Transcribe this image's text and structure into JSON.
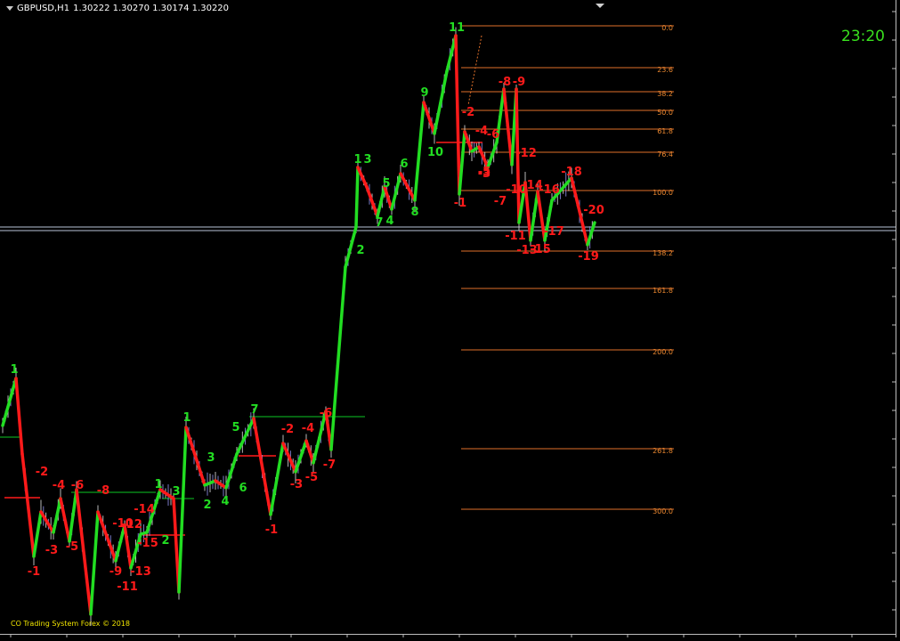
{
  "header": {
    "symbol": "GBPUSD,H1",
    "ohlc": "1.30222 1.30270 1.30174 1.30220"
  },
  "clock": "23:20",
  "credit": "CO Trading System Forex © 2018",
  "colors": {
    "background": "#000000",
    "up_wave": "#22dd22",
    "down_wave": "#ff1a1a",
    "fib_line": "#e0702a",
    "fib_label": "#e8862f",
    "level_line": "#0aa01e",
    "price_line": "#b8c4d8"
  },
  "fibonacci_levels": [
    {
      "label": "0.0"
    },
    {
      "label": "23.6"
    },
    {
      "label": "38.2"
    },
    {
      "label": "50.0"
    },
    {
      "label": "61.8"
    },
    {
      "label": "76.4"
    },
    {
      "label": "100.0"
    },
    {
      "label": "138.2"
    },
    {
      "label": "161.8"
    },
    {
      "label": "200.0"
    },
    {
      "label": "261.8"
    },
    {
      "label": "300.0"
    }
  ],
  "wave_labels_green": [
    "1",
    "1",
    "3",
    "2",
    "1",
    "3",
    "2",
    "4",
    "5",
    "6",
    "7",
    "11",
    "9",
    "10",
    "1",
    "3",
    "5",
    "7",
    "4",
    "6",
    "8",
    "2"
  ],
  "wave_labels_red": [
    "-1",
    "-2",
    "-3",
    "-4",
    "-5",
    "-6",
    "-8",
    "-9",
    "-10",
    "-11",
    "-12",
    "-13",
    "-14",
    "-15",
    "-1",
    "-2",
    "-3",
    "-4",
    "-5",
    "-6",
    "-7",
    "-1",
    "-2",
    "-3",
    "-4",
    "-5",
    "-6",
    "-7",
    "-8",
    "-9",
    "-10",
    "-11",
    "-12",
    "-13",
    "-14",
    "-15",
    "-16",
    "-17",
    "-18",
    "-19",
    "-20"
  ]
}
